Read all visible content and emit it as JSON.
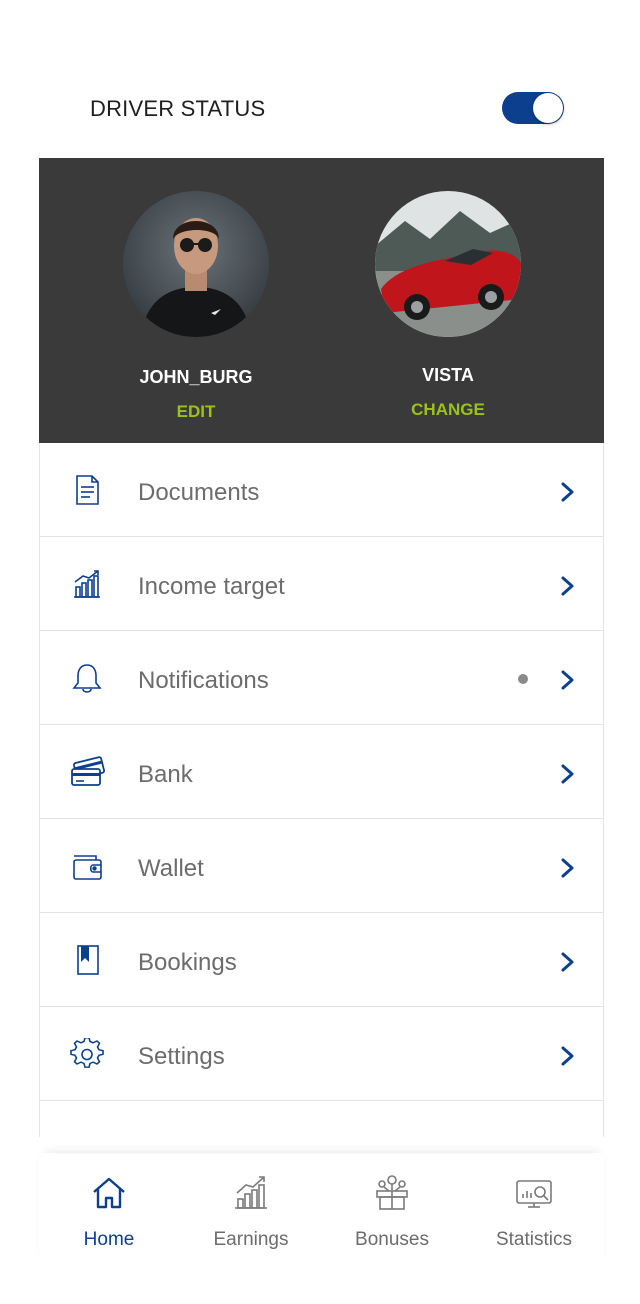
{
  "driver_status": {
    "label": "DRIVER STATUS",
    "enabled": true
  },
  "profiles": [
    {
      "name": "JOHN_BURG",
      "action": "EDIT"
    },
    {
      "name": "VISTA",
      "action": "CHANGE"
    }
  ],
  "menu": [
    {
      "label": "Documents",
      "icon": "document-icon"
    },
    {
      "label": "Income target",
      "icon": "chart-growth-icon"
    },
    {
      "label": "Notifications",
      "icon": "bell-icon",
      "has_indicator": true
    },
    {
      "label": "Bank",
      "icon": "cards-icon"
    },
    {
      "label": "Wallet",
      "icon": "wallet-icon"
    },
    {
      "label": "Bookings",
      "icon": "bookmark-book-icon"
    },
    {
      "label": "Settings",
      "icon": "gear-icon"
    }
  ],
  "bottom_nav": [
    {
      "label": "Home",
      "icon": "home-icon",
      "active": true
    },
    {
      "label": "Earnings",
      "icon": "earnings-chart-icon",
      "active": false
    },
    {
      "label": "Bonuses",
      "icon": "bonus-gift-icon",
      "active": false
    },
    {
      "label": "Statistics",
      "icon": "monitor-stats-icon",
      "active": false
    }
  ],
  "colors": {
    "primary": "#0d3f8f",
    "accent": "#9cc21a",
    "panel": "#3a3a3a",
    "label": "#6c6c6c"
  }
}
